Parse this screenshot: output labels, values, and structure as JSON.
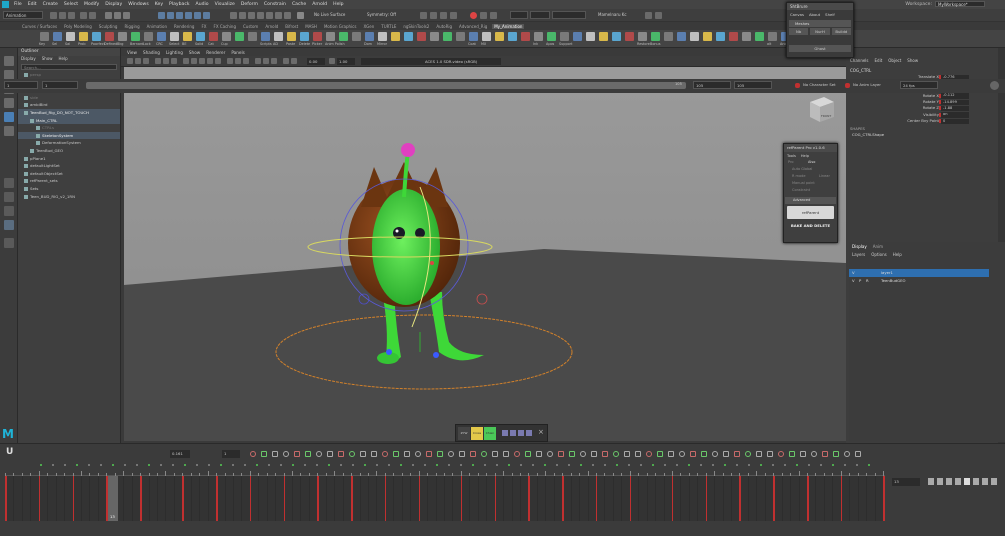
{
  "menubar": {
    "items": [
      "File",
      "Edit",
      "Create",
      "Select",
      "Modify",
      "Display",
      "Windows",
      "Key",
      "Playback",
      "Audio",
      "Visualize",
      "Deform",
      "Constrain",
      "Cache",
      "Arnold",
      "Help"
    ],
    "workspace_label": "Workspace:",
    "workspace_value": "MyWorkspace*"
  },
  "statusline": {
    "menuset": "Animation",
    "live_surface": "No Live Surface",
    "symmetry": "Symmetry: Off",
    "sign_in": "Mamelnaru Kc"
  },
  "shelf_tabs": [
    "Curves / Surfaces",
    "Poly Modeling",
    "Sculpting",
    "Rigging",
    "Animation",
    "Rendering",
    "FX",
    "FX Caching",
    "Custom",
    "Arnold",
    "Bifrost",
    "MASH",
    "Motion Graphics",
    "XGen",
    "TURTLE",
    "ngSkinTools2",
    "AutoRig",
    "Advanced_Rig",
    "My_Animation"
  ],
  "shelf_active": "My_Animation",
  "shelf_labels": [
    "Key",
    "Sel",
    "Sal",
    "Prob",
    "Poorfect",
    "Defined",
    "Bkg",
    "Bernard",
    "Lock",
    "CRC",
    "Select",
    "BE",
    "Solid",
    "Cat",
    "Cup",
    "",
    "",
    "Scripts",
    "AD",
    "Paste",
    "Delete",
    "Picker",
    "Anim Polish",
    "",
    "",
    "Dom",
    "Mirror",
    "",
    "",
    "",
    "",
    "",
    "",
    "Coat",
    "MX",
    "",
    "",
    "",
    "Ink",
    "Apos",
    "Support",
    "",
    "",
    "",
    "",
    "",
    "Restore",
    "Bonus",
    "",
    "",
    "",
    "",
    "",
    "",
    "",
    "",
    "alt",
    "Anim",
    "CTRL"
  ],
  "outliner": {
    "title": "Outliner",
    "menus": [
      "Display",
      "Show",
      "Help"
    ],
    "search_placeholder": "Search...",
    "rows": [
      {
        "label": "persp",
        "dim": true,
        "indent": 0,
        "sel": ""
      },
      {
        "label": "top",
        "dim": true,
        "indent": 0,
        "sel": ""
      },
      {
        "label": "front",
        "dim": true,
        "indent": 0,
        "sel": ""
      },
      {
        "label": "side",
        "dim": true,
        "indent": 0,
        "sel": ""
      },
      {
        "label": "ambiBird",
        "dim": false,
        "indent": 0,
        "sel": ""
      },
      {
        "label": "TeenBud_Rig_DO_NOT_TOUCH",
        "dim": false,
        "indent": 0,
        "sel": "sel2"
      },
      {
        "label": "Main_CTRL",
        "dim": false,
        "indent": 1,
        "sel": "sel2"
      },
      {
        "label": "CTRLs",
        "dim": true,
        "indent": 2,
        "sel": ""
      },
      {
        "label": "SkeletonSystem",
        "dim": false,
        "indent": 2,
        "sel": "sel2"
      },
      {
        "label": "DeformationSystem",
        "dim": false,
        "indent": 2,
        "sel": ""
      },
      {
        "label": "TeenBud_GEO",
        "dim": false,
        "indent": 1,
        "sel": ""
      },
      {
        "label": "pPlane1",
        "dim": false,
        "indent": 0,
        "sel": ""
      },
      {
        "label": "defaultLightSet",
        "dim": false,
        "indent": 0,
        "sel": ""
      },
      {
        "label": "defaultObjectSet",
        "dim": false,
        "indent": 0,
        "sel": ""
      },
      {
        "label": "refParent_sets",
        "dim": false,
        "indent": 0,
        "sel": ""
      },
      {
        "label": "Sets",
        "dim": false,
        "indent": 0,
        "sel": ""
      },
      {
        "label": "Teen_BUD_RIG_v2_1RN",
        "dim": false,
        "indent": 0,
        "sel": ""
      }
    ]
  },
  "viewport": {
    "menus": [
      "View",
      "Shading",
      "Lighting",
      "Show",
      "Renderer",
      "Panels"
    ],
    "field_a": "0.00",
    "field_b": "1.00",
    "colorspace": "ACES 1.0 SDR-video (sRGB)",
    "cube_label": "FRONT"
  },
  "channelbox": {
    "menus": [
      "Channels",
      "Edit",
      "Object",
      "Show"
    ],
    "node": "COG_CTRL",
    "channels": [
      {
        "name": "Translate X",
        "value": "-0.776"
      },
      {
        "name": "Translate Y",
        "value": "-0.176"
      },
      {
        "name": "Translate Z",
        "value": "-0.673"
      },
      {
        "name": "Rotate X",
        "value": "-0.112"
      },
      {
        "name": "Rotate Y",
        "value": "-14.899"
      },
      {
        "name": "Rotate Z",
        "value": "-1.88"
      },
      {
        "name": "Visibility",
        "value": "on"
      },
      {
        "name": "Center Bvy Point",
        "value": "0"
      }
    ],
    "shapes_label": "SHAPES",
    "shape_name": "COG_CTRLShape"
  },
  "layers": {
    "tabs": [
      "Display",
      "Anim"
    ],
    "menus": [
      "Layers",
      "Options",
      "Help"
    ],
    "rows": [
      {
        "v": "V",
        "p": "",
        "r": "",
        "name": "layer1",
        "sel": true
      },
      {
        "v": "V",
        "p": "P",
        "r": "R",
        "name": "TeenBudGEO",
        "sel": false
      }
    ]
  },
  "shelf_window": {
    "title": "ShtBrure",
    "menus": [
      "Canvas",
      "About",
      "Shelf"
    ],
    "row1": "Meshes",
    "row2": [
      "Nb",
      "NurH",
      "Buildd"
    ],
    "footer": "Ghost"
  },
  "refparent_window": {
    "title": "refParent Pro v1.0.6",
    "menus": [
      "Tools",
      "Help"
    ],
    "options": [
      "Pro",
      "Also",
      "Auto Global",
      "R mode",
      "Linear",
      "Manual point",
      "Constraint"
    ],
    "advanced": "Advanced",
    "refparent_btn": "refParent",
    "bake_btn": "BAKE AND DELETE"
  },
  "timeline": {
    "current_frame": "13",
    "start": "1",
    "end": "105",
    "range_start": "1",
    "range_end": "105",
    "anim_start": "105",
    "anim_end": "105",
    "field_a": "0.161",
    "field_b": "1",
    "no_char_set": "No Character Set",
    "no_anim_layer": "No Anim Layer",
    "fps": "24 fps",
    "viewport_sets": [
      "ZYW",
      "Cross",
      "Chain"
    ]
  },
  "colors": {
    "accent": "#5a6d80",
    "key_red": "#c03030",
    "layer_blue": "#2e6fb0",
    "body_green": "#40d63a",
    "body_brown": "#7a3b12"
  }
}
